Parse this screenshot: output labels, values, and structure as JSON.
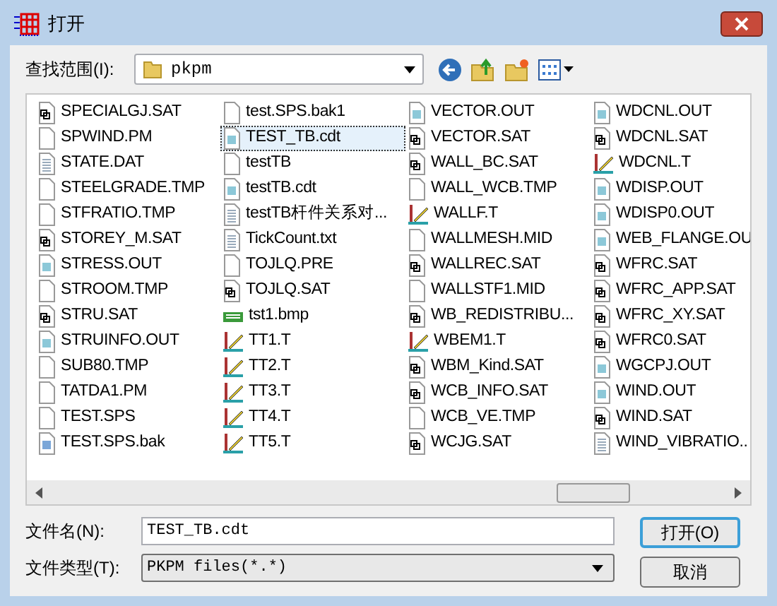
{
  "window": {
    "title": "打开"
  },
  "look_in": {
    "label": "查找范围(I):",
    "value": "pkpm"
  },
  "files": [
    {
      "name": "SPECIALGJ.SAT",
      "kind": "sat",
      "selected": false
    },
    {
      "name": "SPWIND.PM",
      "kind": "blank",
      "selected": false
    },
    {
      "name": "STATE.DAT",
      "kind": "text",
      "selected": false
    },
    {
      "name": "STEELGRADE.TMP",
      "kind": "blank",
      "selected": false
    },
    {
      "name": "STFRATIO.TMP",
      "kind": "blank",
      "selected": false
    },
    {
      "name": "STOREY_M.SAT",
      "kind": "sat",
      "selected": false
    },
    {
      "name": "STRESS.OUT",
      "kind": "out",
      "selected": false
    },
    {
      "name": "STROOM.TMP",
      "kind": "blank",
      "selected": false
    },
    {
      "name": "STRU.SAT",
      "kind": "sat",
      "selected": false
    },
    {
      "name": "STRUINFO.OUT",
      "kind": "out",
      "selected": false
    },
    {
      "name": "SUB80.TMP",
      "kind": "blank",
      "selected": false
    },
    {
      "name": "TATDA1.PM",
      "kind": "blank",
      "selected": false
    },
    {
      "name": "TEST.SPS",
      "kind": "blank",
      "selected": false
    },
    {
      "name": "TEST.SPS.bak",
      "kind": "bak",
      "selected": false
    },
    {
      "name": "test.SPS.bak1",
      "kind": "blank",
      "selected": false
    },
    {
      "name": "TEST_TB.cdt",
      "kind": "out",
      "selected": true
    },
    {
      "name": "testTB",
      "kind": "blank",
      "selected": false
    },
    {
      "name": "testTB.cdt",
      "kind": "out",
      "selected": false
    },
    {
      "name": "testTB杆件关系对...",
      "kind": "text",
      "selected": false
    },
    {
      "name": "TickCount.txt",
      "kind": "text",
      "selected": false
    },
    {
      "name": "TOJLQ.PRE",
      "kind": "blank",
      "selected": false
    },
    {
      "name": "TOJLQ.SAT",
      "kind": "sat",
      "selected": false
    },
    {
      "name": "tst1.bmp",
      "kind": "bmp",
      "selected": false
    },
    {
      "name": "TT1.T",
      "kind": "t",
      "selected": false
    },
    {
      "name": "TT2.T",
      "kind": "t",
      "selected": false
    },
    {
      "name": "TT3.T",
      "kind": "t",
      "selected": false
    },
    {
      "name": "TT4.T",
      "kind": "t",
      "selected": false
    },
    {
      "name": "TT5.T",
      "kind": "t",
      "selected": false
    },
    {
      "name": "VECTOR.OUT",
      "kind": "out",
      "selected": false
    },
    {
      "name": "VECTOR.SAT",
      "kind": "sat",
      "selected": false
    },
    {
      "name": "WALL_BC.SAT",
      "kind": "sat",
      "selected": false
    },
    {
      "name": "WALL_WCB.TMP",
      "kind": "blank",
      "selected": false
    },
    {
      "name": "WALLF.T",
      "kind": "t",
      "selected": false
    },
    {
      "name": "WALLMESH.MID",
      "kind": "blank",
      "selected": false
    },
    {
      "name": "WALLREC.SAT",
      "kind": "sat",
      "selected": false
    },
    {
      "name": "WALLSTF1.MID",
      "kind": "blank",
      "selected": false
    },
    {
      "name": "WB_REDISTRIBU...",
      "kind": "sat",
      "selected": false
    },
    {
      "name": "WBEM1.T",
      "kind": "t",
      "selected": false
    },
    {
      "name": "WBM_Kind.SAT",
      "kind": "sat",
      "selected": false
    },
    {
      "name": "WCB_INFO.SAT",
      "kind": "sat",
      "selected": false
    },
    {
      "name": "WCB_VE.TMP",
      "kind": "blank",
      "selected": false
    },
    {
      "name": "WCJG.SAT",
      "kind": "sat",
      "selected": false
    },
    {
      "name": "WDCNL.OUT",
      "kind": "out",
      "selected": false
    },
    {
      "name": "WDCNL.SAT",
      "kind": "sat",
      "selected": false
    },
    {
      "name": "WDCNL.T",
      "kind": "t",
      "selected": false
    },
    {
      "name": "WDISP.OUT",
      "kind": "out",
      "selected": false
    },
    {
      "name": "WDISP0.OUT",
      "kind": "out",
      "selected": false
    },
    {
      "name": "WEB_FLANGE.OU",
      "kind": "out",
      "selected": false
    },
    {
      "name": "WFRC.SAT",
      "kind": "sat",
      "selected": false
    },
    {
      "name": "WFRC_APP.SAT",
      "kind": "sat",
      "selected": false
    },
    {
      "name": "WFRC_XY.SAT",
      "kind": "sat",
      "selected": false
    },
    {
      "name": "WFRC0.SAT",
      "kind": "sat",
      "selected": false
    },
    {
      "name": "WGCPJ.OUT",
      "kind": "out",
      "selected": false
    },
    {
      "name": "WIND.OUT",
      "kind": "out",
      "selected": false
    },
    {
      "name": "WIND.SAT",
      "kind": "sat",
      "selected": false
    },
    {
      "name": "WIND_VIBRATIO..",
      "kind": "text",
      "selected": false
    }
  ],
  "file_name": {
    "label": "文件名(N):",
    "value": "TEST_TB.cdt"
  },
  "file_type": {
    "label": "文件类型(T):",
    "value": "PKPM files(*.*)"
  },
  "buttons": [
    "打开(O)",
    "取消"
  ]
}
